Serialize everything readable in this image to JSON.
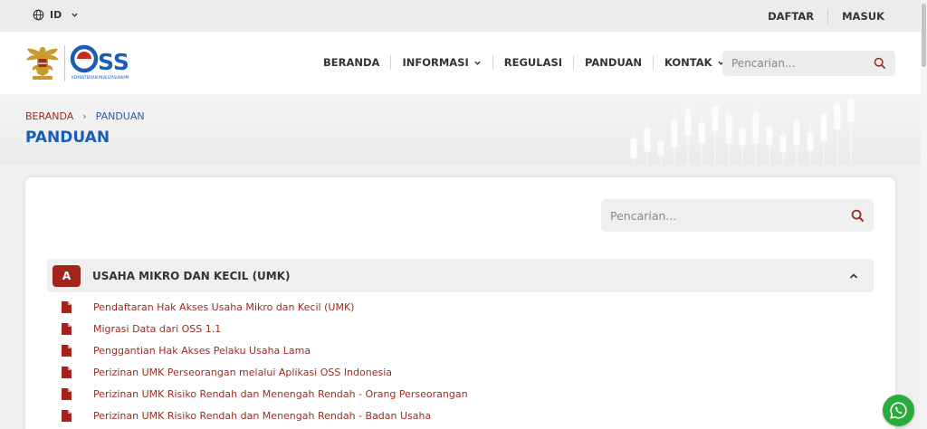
{
  "topbar": {
    "language": "ID",
    "register_label": "DAFTAR",
    "login_label": "MASUK"
  },
  "header": {
    "logo_text": "OSS",
    "logo_subtitle": "KEMENTERIAN INVESTASI/BKPM",
    "nav": [
      "BERANDA",
      "INFORMASI",
      "REGULASI",
      "PANDUAN",
      "KONTAK"
    ],
    "search_placeholder": "Pencarian..."
  },
  "breadcrumb": {
    "home": "BERANDA",
    "separator": "›",
    "current": "PANDUAN"
  },
  "page_title": "PANDUAN",
  "content": {
    "search_placeholder": "Pencarian...",
    "section": {
      "badge": "A",
      "title": "USAHA MIKRO DAN KECIL (UMK)",
      "documents": [
        "Pendaftaran Hak Akses Usaha Mikro dan Kecil (UMK)",
        "Migrasi Data dari OSS 1.1",
        "Penggantian Hak Akses Pelaku Usaha Lama",
        "Perizinan UMK Perseorangan melalui Aplikasi OSS Indonesia",
        "Perizinan UMK Risiko Rendah dan Menengah Rendah - Orang Perseorangan",
        "Perizinan UMK Risiko Rendah dan Menengah Rendah - Badan Usaha"
      ]
    }
  },
  "icons": {
    "language": "globe-icon",
    "dropdown": "chevron-down-icon",
    "search": "search-icon",
    "collapse": "chevron-up-icon",
    "document": "pdf-file-icon",
    "chat": "whatsapp-icon"
  },
  "colors": {
    "brand_blue": "#1b5db5",
    "brand_red": "#a3241d",
    "link_red": "#9c2b22",
    "whatsapp_green": "#27ad3a"
  }
}
